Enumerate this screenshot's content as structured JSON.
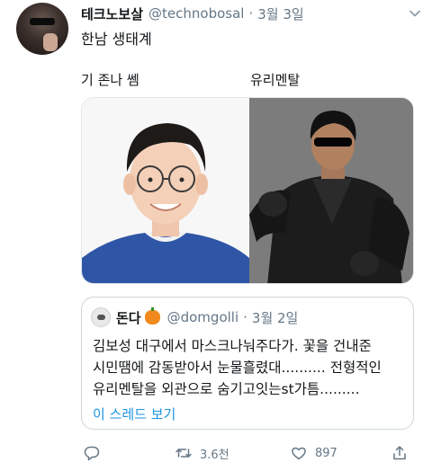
{
  "tweet": {
    "author_name": "테크노보살",
    "author_handle": "@technobosal",
    "separator": "·",
    "date": "3월 3일",
    "text": "한남 생태계"
  },
  "captions": {
    "left": "기 존나 쎔",
    "right": "유리멘탈"
  },
  "quoted_tweet": {
    "author_name": "돈다",
    "author_handle": "@domgolli",
    "separator": "·",
    "date": "3월 2일",
    "lines": [
      "김보성 대구에서 마스크나눠주다가. 꽃을 건내준",
      "시민땜에 감동받아서 눈물흘렸대.......... 전형적인",
      "유리멘탈을 외관으로 숨기고잇는st가틈........."
    ],
    "show_thread_link": "이 스레드 보기"
  },
  "actions": {
    "retweet_count": "3.6천",
    "like_count": "897"
  },
  "icons": {
    "more": "chevron-down-icon",
    "reply": "reply-icon",
    "retweet": "retweet-icon",
    "like": "heart-icon",
    "share": "share-icon"
  },
  "colors": {
    "link": "#1b95e0",
    "muted": "#657786",
    "text": "#14171a"
  }
}
